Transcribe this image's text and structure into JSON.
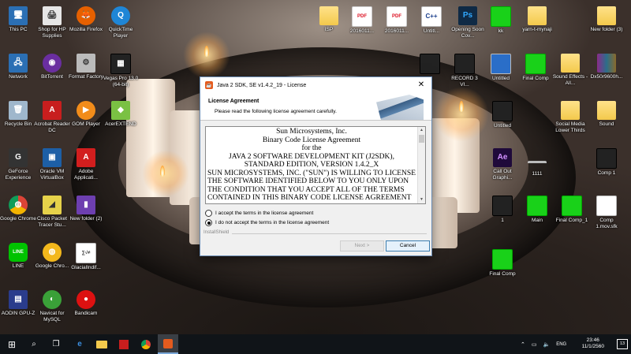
{
  "desktop": {
    "icons": [
      {
        "label": "This PC",
        "glyph": "🖥"
      },
      {
        "label": "Shop for HP Supplies",
        "glyph": "🖨"
      },
      {
        "label": "Mozilla Firefox",
        "glyph": "🦊"
      },
      {
        "label": "QuickTime Player",
        "glyph": "Q"
      },
      {
        "label": "Network",
        "glyph": "🖧"
      },
      {
        "label": "BitTorrent",
        "glyph": "◉"
      },
      {
        "label": "Format Factory",
        "glyph": "⚙"
      },
      {
        "label": "Vegas Pro 13.0 (64-bit)",
        "glyph": "▦"
      },
      {
        "label": "Recycle Bin",
        "glyph": "🗑"
      },
      {
        "label": "Acrobat Reader DC",
        "glyph": "A"
      },
      {
        "label": "GOM Player",
        "glyph": "▶"
      },
      {
        "label": "AcerEXTEND",
        "glyph": "◆"
      },
      {
        "label": "GeForce Experience",
        "glyph": "G"
      },
      {
        "label": "Oracle VM VirtualBox",
        "glyph": "▣"
      },
      {
        "label": "Adobe Applicati...",
        "glyph": "A"
      },
      {
        "label": "Google Chrome",
        "glyph": "◍"
      },
      {
        "label": "Cisco Packet Tracer Stu...",
        "glyph": "◢"
      },
      {
        "label": "New folder (2)",
        "glyph": "▮"
      },
      {
        "label": "LINE",
        "glyph": "LINE"
      },
      {
        "label": "Google Chro...",
        "glyph": "◍"
      },
      {
        "label": "GlacialIndif...",
        "glyph": "∑√≠"
      },
      {
        "label": "AODIN GPU-Z",
        "glyph": "▤"
      },
      {
        "label": "Navicat for MySQL",
        "glyph": "◐"
      },
      {
        "label": "Bandicam",
        "glyph": "●"
      },
      {
        "label": "ISP",
        "glyph": ""
      },
      {
        "label": "2016011...",
        "glyph": "PDF"
      },
      {
        "label": "2016011...",
        "glyph": "PDF"
      },
      {
        "label": "Untitl...",
        "glyph": "C++"
      },
      {
        "label": "Opening Soon Cov...",
        "glyph": "Ps"
      },
      {
        "label": "kk",
        "glyph": ""
      },
      {
        "label": "yarn-t-mynaji",
        "glyph": ""
      },
      {
        "label": "New folder (3)",
        "glyph": ""
      },
      {
        "label": "...",
        "glyph": ""
      },
      {
        "label": "RECORD 3 VI...",
        "glyph": ""
      },
      {
        "label": "Untitled",
        "glyph": ""
      },
      {
        "label": "Final Comp",
        "glyph": ""
      },
      {
        "label": "Sound Effects - All...",
        "glyph": ""
      },
      {
        "label": "Dx50r9600h...",
        "glyph": ""
      },
      {
        "label": "Untitled",
        "glyph": ""
      },
      {
        "label": "Social Media Lower Thirds",
        "glyph": ""
      },
      {
        "label": "Sound",
        "glyph": ""
      },
      {
        "label": "Call Out Graphi...",
        "glyph": "Ae"
      },
      {
        "label": "1111",
        "glyph": ""
      },
      {
        "label": "Comp 1",
        "glyph": ""
      },
      {
        "label": "1",
        "glyph": ""
      },
      {
        "label": "Main",
        "glyph": ""
      },
      {
        "label": "Final Comp_1",
        "glyph": ""
      },
      {
        "label": "Comp 1.mov.sfk",
        "glyph": ""
      },
      {
        "label": "Final Comp",
        "glyph": ""
      }
    ]
  },
  "window": {
    "title": "Java 2 SDK, SE v1.4.2_19 - License",
    "close_glyph": "✕",
    "header_title": "License Agreement",
    "header_subtitle": "Please read the following license agreement carefully.",
    "license_lines": [
      "Sun Microsystems, Inc.",
      "Binary Code License Agreement",
      "for the",
      "JAVA 2 SOFTWARE DEVELOPMENT KIT (J2SDK),",
      "STANDARD EDITION, VERSION 1.4.2_X"
    ],
    "license_body": "SUN MICROSYSTEMS, INC. (\"SUN\") IS WILLING TO LICENSE THE SOFTWARE IDENTIFIED BELOW TO YOU ONLY UPON THE CONDITION THAT YOU ACCEPT ALL OF THE TERMS CONTAINED IN THIS BINARY CODE LICENSE AGREEMENT",
    "radio_accept": "I accept the terms in the license agreement",
    "radio_decline": "I do not accept the terms in the license agreement",
    "selected": "decline",
    "footer_brand": "InstallShield",
    "next_label": "Next >",
    "cancel_label": "Cancel"
  },
  "taskbar": {
    "start_glyph": "⊞",
    "search_glyph": "⌕",
    "taskview_glyph": "❐",
    "time": "23:46",
    "date": "11/1/2560",
    "language": "ENG",
    "notifications": "13"
  }
}
